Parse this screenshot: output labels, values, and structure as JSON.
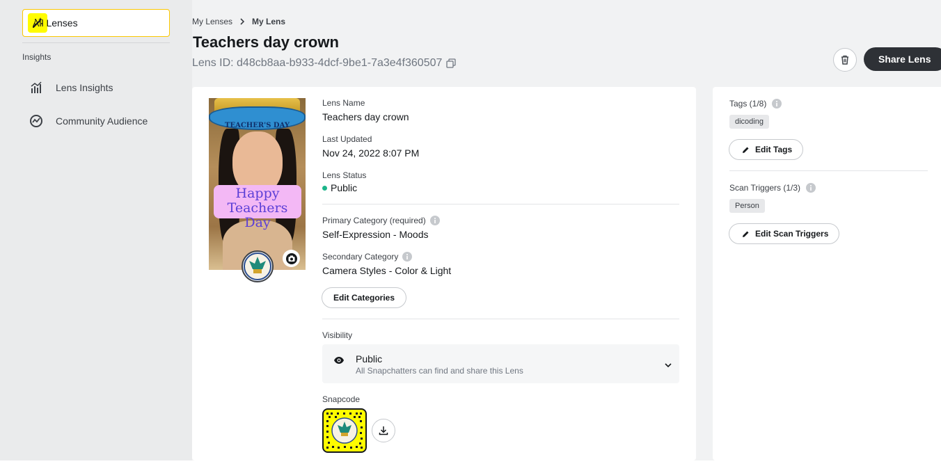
{
  "sidebar": {
    "all_lenses_label": "All Lenses",
    "section_label": "Insights",
    "items": [
      {
        "label": "Lens Insights",
        "icon": "bar-chart-icon"
      },
      {
        "label": "Community Audience",
        "icon": "trend-circle-icon"
      }
    ]
  },
  "header": {
    "breadcrumb": [
      "My Lenses",
      "My Lens"
    ],
    "title": "Teachers day crown",
    "lens_id": "Lens ID: d48cb8aa-b933-4dcf-9be1-7a3e4f360507",
    "share_label": "Share Lens"
  },
  "preview": {
    "banner_text": "TEACHER'S DAY",
    "overlay_line1": "Happy",
    "overlay_line2": "Teachers Day"
  },
  "details": {
    "lens_name_label": "Lens Name",
    "lens_name": "Teachers day crown",
    "last_updated_label": "Last Updated",
    "last_updated": "Nov 24, 2022 8:07 PM",
    "status_label": "Lens Status",
    "status": "Public",
    "status_color": "#1cb58a",
    "primary_category_label": "Primary Category (required)",
    "primary_category": "Self-Expression - Moods",
    "secondary_category_label": "Secondary Category",
    "secondary_category": "Camera Styles - Color & Light",
    "edit_categories_label": "Edit Categories",
    "visibility_label": "Visibility",
    "visibility_value": "Public",
    "visibility_desc": "All Snapchatters can find and share this Lens",
    "snapcode_label": "Snapcode"
  },
  "side": {
    "tags_label": "Tags (1/8)",
    "tags": [
      "dicoding"
    ],
    "edit_tags_label": "Edit Tags",
    "scan_triggers_label": "Scan Triggers (1/3)",
    "scan_triggers": [
      "Person"
    ],
    "edit_scan_triggers_label": "Edit Scan Triggers"
  },
  "colors": {
    "brand_yellow": "#fffc00",
    "share_button": "#2e3136",
    "accent_border": "#fbc700"
  }
}
